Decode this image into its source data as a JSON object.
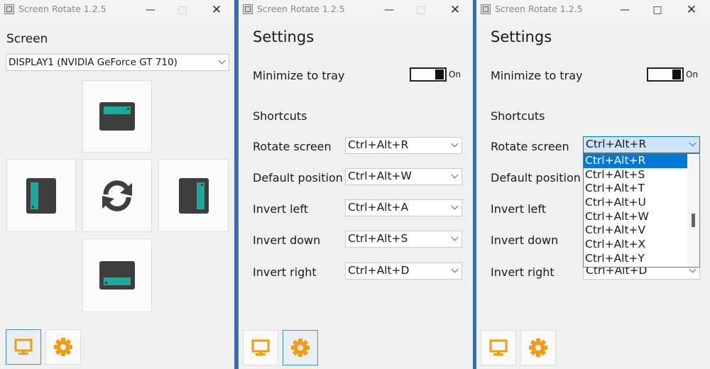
{
  "windows": [
    {
      "title": "Screen Rotate 1.2.5",
      "screen_label": "Screen",
      "display_value": "DISPLAY1 (NVIDIA GeForce GT 710)"
    },
    {
      "title": "Screen Rotate 1.2.5",
      "settings_heading": "Settings",
      "minimize_label": "Minimize to tray",
      "toggle_state": "On",
      "shortcuts_heading": "Shortcuts",
      "shortcuts": [
        {
          "label": "Rotate screen",
          "value": "Ctrl+Alt+R"
        },
        {
          "label": "Default position",
          "value": "Ctrl+Alt+W"
        },
        {
          "label": "Invert left",
          "value": "Ctrl+Alt+A"
        },
        {
          "label": "Invert down",
          "value": "Ctrl+Alt+S"
        },
        {
          "label": "Invert right",
          "value": "Ctrl+Alt+D"
        }
      ]
    },
    {
      "title": "Screen Rotate 1.2.5",
      "settings_heading": "Settings",
      "minimize_label": "Minimize to tray",
      "toggle_state": "On",
      "shortcuts_heading": "Shortcuts",
      "shortcuts": [
        {
          "label": "Rotate screen",
          "value": "Ctrl+Alt+R"
        },
        {
          "label": "Default position",
          "value": ""
        },
        {
          "label": "Invert left",
          "value": ""
        },
        {
          "label": "Invert down",
          "value": ""
        },
        {
          "label": "Invert right",
          "value": "Ctrl+Alt+D"
        }
      ],
      "dropdown_options": [
        "Ctrl+Alt+R",
        "Ctrl+Alt+S",
        "Ctrl+Alt+T",
        "Ctrl+Alt+U",
        "Ctrl+Alt+W",
        "Ctrl+Alt+V",
        "Ctrl+Alt+X",
        "Ctrl+Alt+Y"
      ],
      "dropdown_selected_index": 0
    }
  ],
  "icons": {
    "orientation": [
      "landscape-screen-icon",
      "portrait-left-screen-icon",
      "rotate-icon",
      "portrait-right-screen-icon",
      "landscape-flipped-screen-icon"
    ],
    "nav": [
      "monitor-icon",
      "gear-icon"
    ]
  },
  "colors": {
    "accent": "#0078d7",
    "screen_body": "#3e3e3e",
    "screen_bar": "#1ea79b",
    "nav_icon": "#f39c12"
  }
}
